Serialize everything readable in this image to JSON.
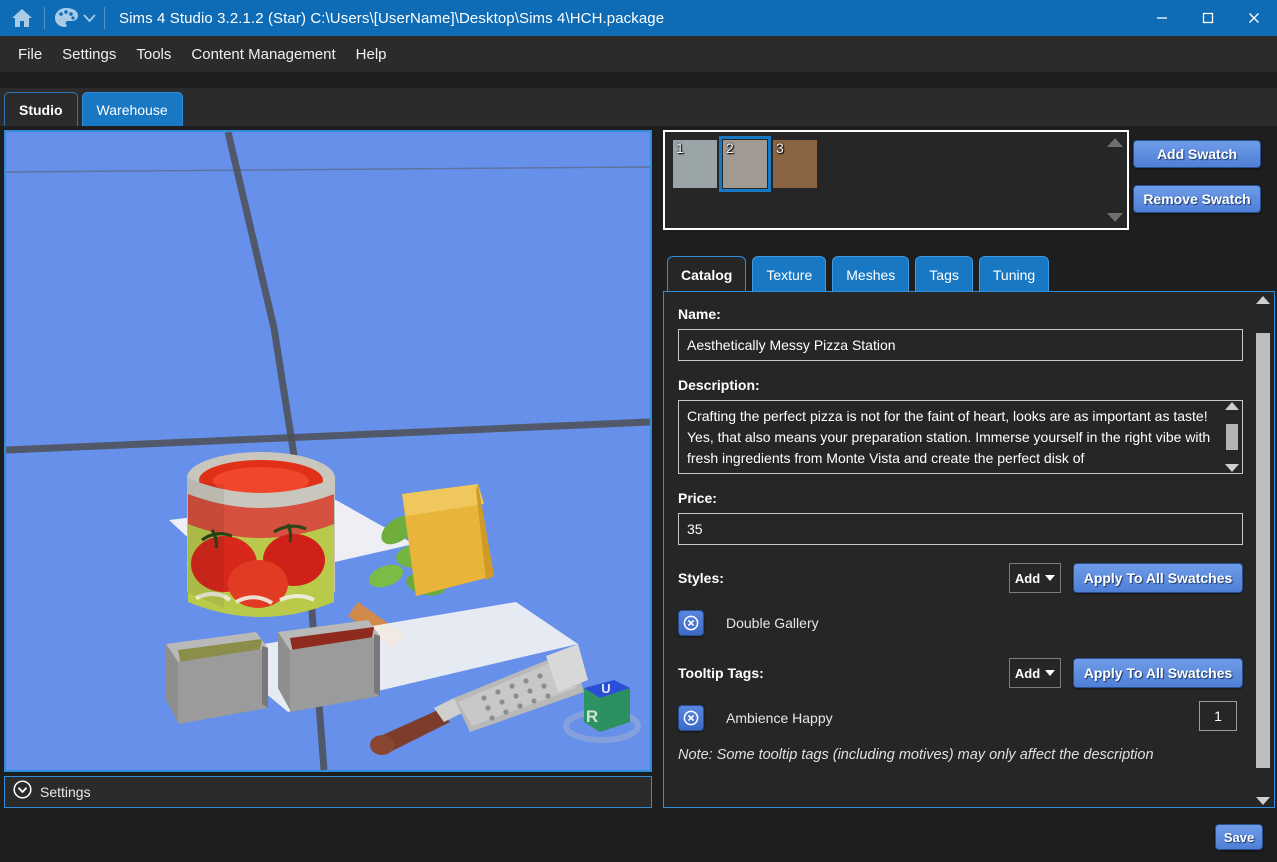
{
  "titlebar": {
    "home_icon": "home-icon",
    "palette_icon": "palette-icon",
    "title": "Sims 4 Studio 3.2.1.2 (Star)  C:\\Users\\[UserName]\\Desktop\\Sims 4\\HCH.package",
    "minimize": "minimize-icon",
    "maximize": "maximize-icon",
    "close": "close-icon",
    "accent": "#0e6bb5"
  },
  "menubar": {
    "items": [
      {
        "label": "File"
      },
      {
        "label": "Settings"
      },
      {
        "label": "Tools"
      },
      {
        "label": "Content Management"
      },
      {
        "label": "Help"
      }
    ]
  },
  "main_tabs": [
    {
      "label": "Studio",
      "active": true
    },
    {
      "label": "Warehouse",
      "active": false
    }
  ],
  "viewport": {
    "background_color": "#6690ea",
    "border_color": "#2f8ddb",
    "gizmo": {
      "top_face_label": "U",
      "front_face_label": "R",
      "top_color": "#2a4fd6",
      "front_color": "#2e9362"
    }
  },
  "settings_bar": {
    "label": "Settings",
    "icon": "chevron-down-circle-icon"
  },
  "swatches": {
    "items": [
      {
        "number": "1",
        "color": "#9aa5a8",
        "selected": false
      },
      {
        "number": "2",
        "color": "#a09a93",
        "selected": true
      },
      {
        "number": "3",
        "color": "#8b6443",
        "selected": false
      }
    ],
    "add_label": "Add Swatch",
    "remove_label": "Remove Swatch"
  },
  "sub_tabs": [
    {
      "label": "Catalog",
      "active": true
    },
    {
      "label": "Texture",
      "active": false
    },
    {
      "label": "Meshes",
      "active": false
    },
    {
      "label": "Tags",
      "active": false
    },
    {
      "label": "Tuning",
      "active": false
    }
  ],
  "catalog": {
    "name_label": "Name:",
    "name_value": "Aesthetically Messy Pizza Station",
    "description_label": "Description:",
    "description_value": "Crafting the perfect pizza is not for the faint of heart, looks are as important as taste! Yes, that also means your preparation station. Immerse yourself in the right vibe with fresh ingredients from Monte Vista and create the perfect disk of",
    "price_label": "Price:",
    "price_value": "35",
    "styles_label": "Styles:",
    "styles_add_label": "Add",
    "styles_apply_label": "Apply To All Swatches",
    "styles_items": [
      {
        "name": "Double Gallery",
        "delete_icon": "delete-circle-icon"
      }
    ],
    "tooltip_tags_label": "Tooltip Tags:",
    "tooltip_add_label": "Add",
    "tooltip_apply_label": "Apply To All Swatches",
    "tooltip_items": [
      {
        "name": "Ambience Happy",
        "count": "1",
        "delete_icon": "delete-circle-icon"
      }
    ],
    "note": "Note: Some tooltip tags (including motives) may only affect the description"
  },
  "footer": {
    "save_label": "Save"
  }
}
